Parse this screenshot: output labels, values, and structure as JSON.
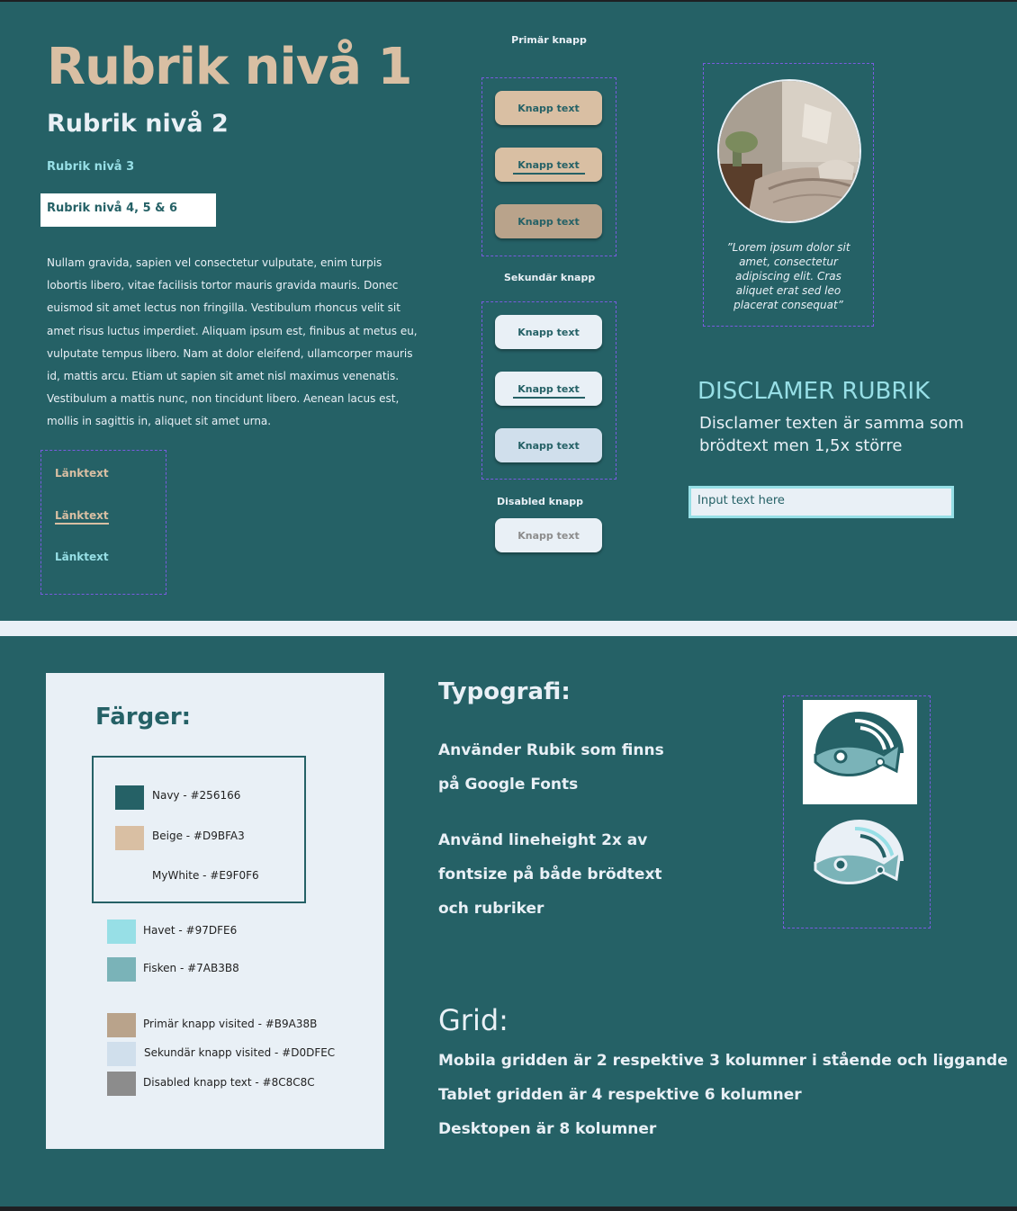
{
  "top": {
    "heading1": "Rubrik nivå 1",
    "heading2": "Rubrik nivå 2",
    "heading3": "Rubrik nivå 3",
    "heading456": "Rubrik nivå 4, 5 & 6",
    "body_text": "Nullam gravida, sapien vel consectetur vulputate, enim turpis lobortis libero, vitae facilisis tortor mauris gravida mauris. Donec euismod sit amet lectus non fringilla. Vestibulum rhoncus velit sit amet risus luctus imperdiet. Aliquam ipsum est, finibus at metus eu, vulputate tempus libero. Nam at dolor eleifend, ullamcorper mauris id, mattis arcu. Etiam ut sapien sit amet nisl maximus venenatis. Vestibulum a mattis nunc, non tincidunt libero. Aenean lacus est, mollis in sagittis in, aliquet sit amet urna.",
    "links": [
      "Länktext",
      "Länktext",
      "Länktext"
    ],
    "primary_label": "Primär knapp",
    "secondary_label": "Sekundär knapp",
    "disabled_label": "Disabled knapp",
    "button_text": "Knapp text",
    "quote": "”Lorem ipsum dolor sit amet, consectetur adipiscing elit. Cras aliquet erat sed leo placerat consequat”",
    "disclaimer_heading": "DISCLAMER RUBRIK",
    "disclaimer_text": "Disclamer texten är samma som brödtext men 1,5x större",
    "input_value": "Input text here"
  },
  "colors": {
    "title": "Färger:",
    "swatches": [
      {
        "label": "Navy - #256166",
        "hex": "#256166"
      },
      {
        "label": "Beige - #D9BFA3",
        "hex": "#D9BFA3"
      },
      {
        "label": "MyWhite - #E9F0F6",
        "hex": "#E9F0F6"
      },
      {
        "label": "Havet - #97DFE6",
        "hex": "#97DFE6"
      },
      {
        "label": "Fisken - #7AB3B8",
        "hex": "#7AB3B8"
      },
      {
        "label": "Primär knapp visited - #B9A38B",
        "hex": "#B9A38B"
      },
      {
        "label": "Sekundär knapp visited - #D0DFEC",
        "hex": "#D0DFEC"
      },
      {
        "label": "Disabled knapp text - #8C8C8C",
        "hex": "#8C8C8C"
      }
    ]
  },
  "typography": {
    "title": "Typografi:",
    "lines": [
      "Använder Rubik som finns",
      "på Google Fonts",
      "Använd lineheight 2x av",
      "fontsize på både brödtext",
      "och rubriker"
    ]
  },
  "grid": {
    "title": "Grid:",
    "lines": [
      "Mobila gridden är 2 respektive 3 kolumner i stående och liggande",
      "Tablet gridden är 4 respektive 6 kolumner",
      "Desktopen är 8 kolumner"
    ]
  }
}
